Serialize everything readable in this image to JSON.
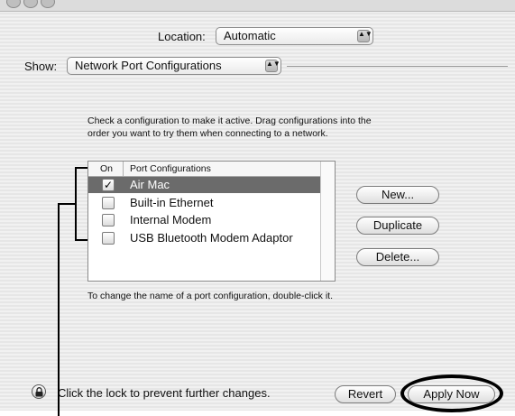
{
  "location": {
    "label": "Location:",
    "value": "Automatic"
  },
  "show": {
    "label": "Show:",
    "value": "Network Port Configurations"
  },
  "instructions": {
    "line1": "Check a configuration to make it active. Drag configurations into the",
    "line2": "order you want to try them when connecting to a network."
  },
  "list": {
    "columns": {
      "on": "On",
      "name": "Port Configurations"
    },
    "rows": [
      {
        "label": "Air Mac",
        "checked": true,
        "selected": true,
        "mark": "✓"
      },
      {
        "label": "Built-in Ethernet",
        "checked": false,
        "selected": false,
        "mark": ""
      },
      {
        "label": "Internal Modem",
        "checked": false,
        "selected": false,
        "mark": ""
      },
      {
        "label": "USB Bluetooth Modem Adaptor",
        "checked": false,
        "selected": false,
        "mark": ""
      }
    ]
  },
  "buttons": {
    "new": "New...",
    "duplicate": "Duplicate",
    "delete": "Delete...",
    "revert": "Revert",
    "apply": "Apply Now"
  },
  "hint": "To change the name of a port configuration, double-click it.",
  "lock_text": "Click the lock to prevent further changes.",
  "popup_arrows": "▲▼"
}
